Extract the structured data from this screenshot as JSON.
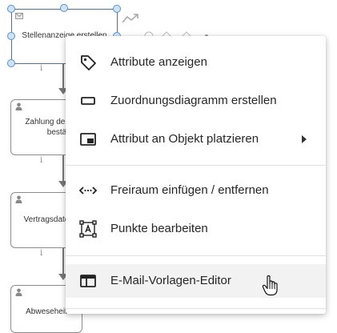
{
  "diagram": {
    "selected_node": {
      "label": "Stellenanzeige erstellen"
    },
    "node2": {
      "line1": "Zahlung der",
      "line2": "bestä"
    },
    "node3": {
      "label": "Vertragsdate"
    },
    "node4": {
      "label": "Abweseheit"
    },
    "info_symbol": "i"
  },
  "context_menu": {
    "items": [
      {
        "label": "Attribute anzeigen",
        "icon": "tag-icon"
      },
      {
        "label": "Zuordnungsdiagramm erstellen",
        "icon": "rectangle-icon"
      },
      {
        "label": "Attribut an Objekt platzieren",
        "icon": "place-attribute-icon",
        "has_submenu": true
      },
      {
        "label": "Freiraum einfügen / entfernen",
        "icon": "insert-space-icon"
      },
      {
        "label": "Punkte bearbeiten",
        "icon": "edit-points-icon"
      },
      {
        "label": "E-Mail-Vorlagen-Editor",
        "icon": "email-template-icon",
        "hovered": true
      }
    ]
  }
}
